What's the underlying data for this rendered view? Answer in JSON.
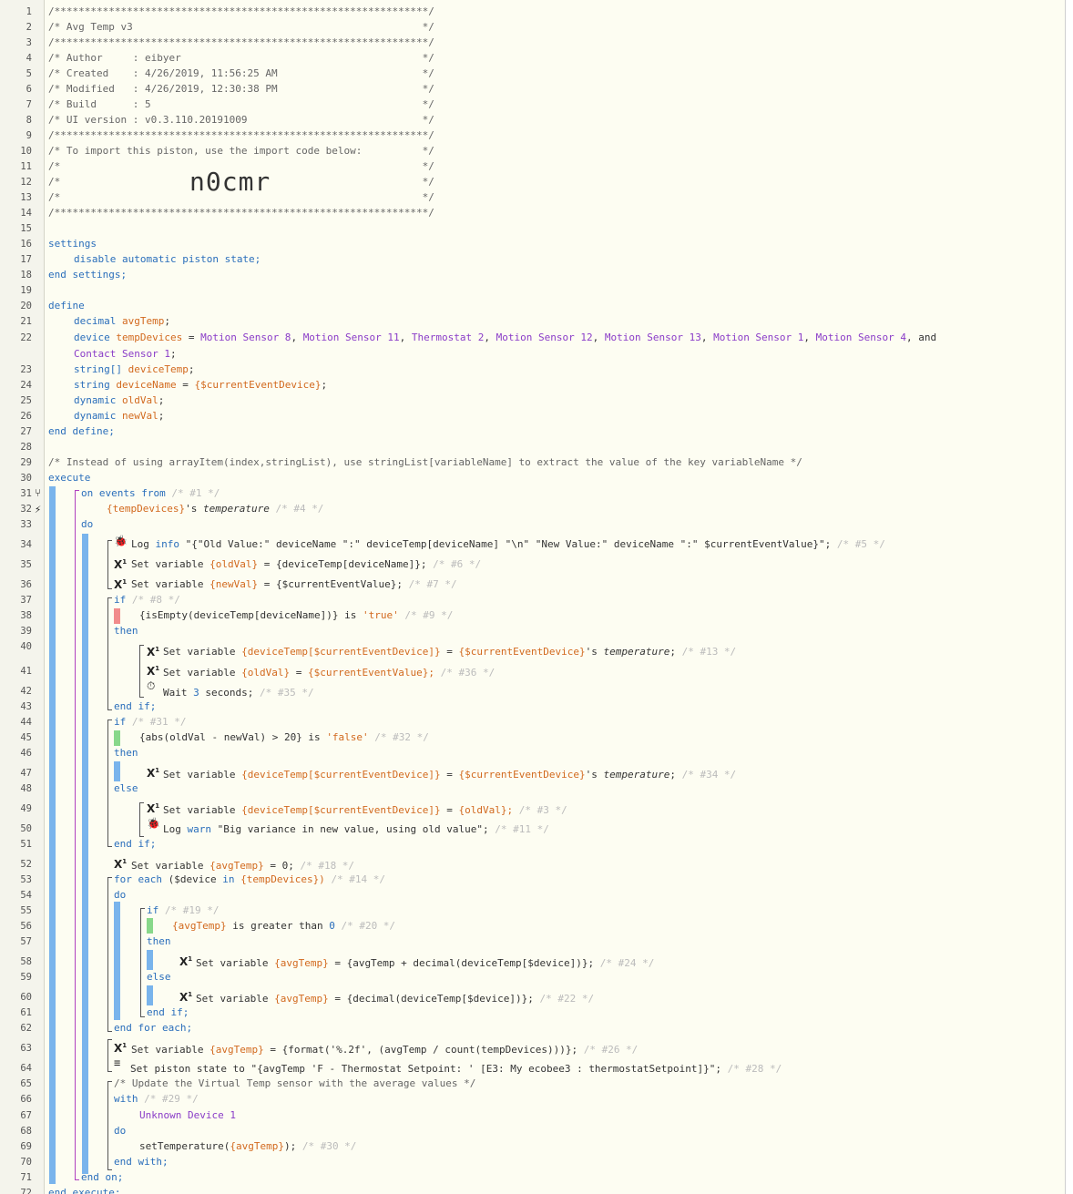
{
  "lines": {
    "1": "/**************************************************************/",
    "2": "/* Avg Temp v3                                                */",
    "3": "/**************************************************************/",
    "4": "/* Author     : eibyer                                        */",
    "5": "/* Created    : 4/26/2019, 11:56:25 AM                        */",
    "6": "/* Modified   : 4/26/2019, 12:30:38 PM                        */",
    "7": "/* Build      : 5                                             */",
    "8": "/* UI version : v0.3.110.20191009                             */",
    "9": "/**************************************************************/",
    "10": "/* To import this piston, use the import code below:          */",
    "11": "/*                                                            */",
    "12": "/*                                                            */",
    "13": "/*                                                            */",
    "14": "/**************************************************************/",
    "29": "/* Instead of using arrayItem(index,stringList), use stringList[variableName] to extract the value of the key variableName */",
    "65": "/* Update the Virtual Temp sensor with the average values */"
  },
  "import_code": "n0cmr",
  "kw": {
    "settings": "settings",
    "end_settings": "end settings;",
    "define": "define",
    "end_define": "end define;",
    "execute": "execute",
    "end_execute": "end execute;",
    "on_events_from": "on events from",
    "do": "do",
    "end_on": "end on;",
    "if": "if",
    "then": "then",
    "else": "else",
    "end_if": "end if;",
    "for_each": "for each",
    "end_for_each": "end for each;",
    "with": "with",
    "end_with": "end with;",
    "set_variable": "Set variable",
    "log_info": "Log info",
    "log_warn": "Log warn",
    "wait": "Wait",
    "set_piston_state": "Set piston state to",
    "disable": "disable",
    "automatic_piston_state": "automatic piston state;"
  },
  "defs": {
    "decimal": "decimal",
    "avgTemp": "avgTemp",
    "device": "device",
    "tempDevices": "tempDevices",
    "devices": [
      "Motion Sensor 8",
      "Motion Sensor 11",
      "Thermostat 2",
      "Motion Sensor 12",
      "Motion Sensor 13",
      "Motion Sensor 1",
      "Motion Sensor 4"
    ],
    "and": "and",
    "contact": "Contact Sensor 1",
    "string_arr": "string[]",
    "deviceTemp": "deviceTemp",
    "string": "string",
    "deviceName": "deviceName",
    "deviceName_val": "{$currentEventDevice}",
    "dynamic": "dynamic",
    "oldVal": "oldVal",
    "newVal": "newVal"
  },
  "code": {
    "trigger_devices": "{tempDevices}",
    "trigger_attr": "'s",
    "temperature": "temperature",
    "c4": "/* #4 */",
    "c1": "/* #1 */",
    "log5": "\"{\"Old Value:\" deviceName \":\" deviceTemp[deviceName] \"\\n\" \"New Value:\" deviceName \":\" $currentEventValue}\";",
    "c5": "/* #5 */",
    "oldVal_v": "{oldVal}",
    "s6_expr": "{deviceTemp[deviceName]};",
    "c6": "/* #6 */",
    "newVal_v": "{newVal}",
    "s7_expr": "{$currentEventValue};",
    "c7": "/* #7 */",
    "c8": "/* #8 */",
    "cond9": "{isEmpty(deviceTemp[deviceName])}",
    "is": "is",
    "true": "'true'",
    "c9": "/* #9 */",
    "dt_v": "{deviceTemp[$currentEventDevice]}",
    "ced": "{$currentEventDevice}",
    "c13": "/* #13 */",
    "cev": "{$currentEventValue};",
    "c36": "/* #36 */",
    "wait_n": "3",
    "seconds": "seconds;",
    "c35": "/* #35 */",
    "c31": "/* #31 */",
    "cond32": "{abs(oldVal - newVal) > 20}",
    "false": "'false'",
    "c32": "/* #32 */",
    "c34": "/* #34 */",
    "oldVal_e": "{oldVal};",
    "c3": "/* #3 */",
    "warn": "\"Big variance in new value, using old value\";",
    "c11": "/* #11 */",
    "avgTemp_v": "{avgTemp}",
    "zero": "0;",
    "c18": "/* #18 */",
    "device_var": "($device",
    "in": "in",
    "tempDevices_v": "{tempDevices})",
    "c14": "/* #14 */",
    "c19": "/* #19 */",
    "greater": "is greater than",
    "zero_n": "0",
    "c20": "/* #20 */",
    "expr24": "{avgTemp + decimal(deviceTemp[$device])};",
    "c24": "/* #24 */",
    "expr22": "{decimal(deviceTemp[$device])};",
    "c22": "/* #22 */",
    "expr26": "{format('%.2f', (avgTemp / count(tempDevices)))};",
    "c26": "/* #26 */",
    "state": "\"{avgTemp 'F - Thermostat Setpoint: ' [E3: My ecobee3 : thermostatSetpoint]}\";",
    "c28": "/* #28 */",
    "c29": "/* #29 */",
    "unknown": "Unknown Device 1",
    "setTemp": "setTemperature(",
    "setTemp_end": ");",
    "c30": "/* #30 */",
    "eq": "="
  }
}
